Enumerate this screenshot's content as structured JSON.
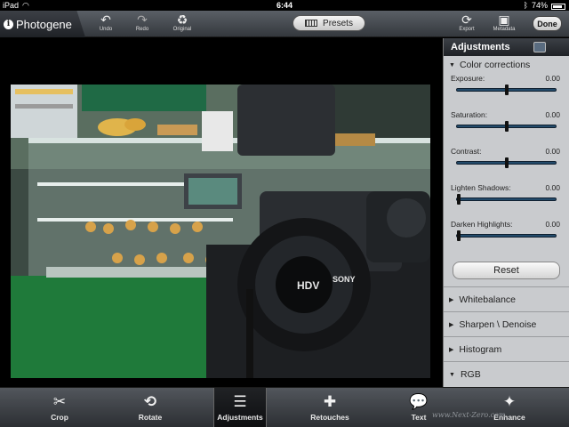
{
  "statusbar": {
    "device": "iPad",
    "time": "6:44",
    "battery": "74%"
  },
  "app": {
    "name": "Photogene",
    "logo_letter": "i"
  },
  "toolbar": {
    "undo": "Undo",
    "redo": "Redo",
    "original": "Original",
    "presets": "Presets",
    "export": "Export",
    "metadata": "Metadata",
    "done": "Done"
  },
  "panel": {
    "title": "Adjustments",
    "color_corrections": "Color corrections",
    "sliders": [
      {
        "label": "Exposure:",
        "value": "0.00",
        "level": 0.5
      },
      {
        "label": "Saturation:",
        "value": "0.00",
        "level": 0.5
      },
      {
        "label": "Contrast:",
        "value": "0.00",
        "level": 0.5
      },
      {
        "label": "Lighten Shadows:",
        "value": "0.00",
        "level": 0.0
      },
      {
        "label": "Darken Highlights:",
        "value": "0.00",
        "level": 0.0
      }
    ],
    "reset": "Reset",
    "sections": [
      "Whitebalance",
      "Sharpen \\ Denoise",
      "Histogram",
      "RGB"
    ]
  },
  "bottombar": {
    "items": [
      {
        "label": "Crop",
        "icon": "scissors-icon"
      },
      {
        "label": "Rotate",
        "icon": "rotate-icon"
      },
      {
        "label": "Adjustments",
        "icon": "sliders-icon"
      },
      {
        "label": "Retouches",
        "icon": "bandage-icon"
      },
      {
        "label": "Text",
        "icon": "speech-bubble-icon"
      },
      {
        "label": "Enhance",
        "icon": "magic-icon"
      }
    ]
  },
  "photo": {
    "camera_brand": "SONY",
    "camera_model": "HDV"
  },
  "watermark": "www.Next-Zero.com"
}
